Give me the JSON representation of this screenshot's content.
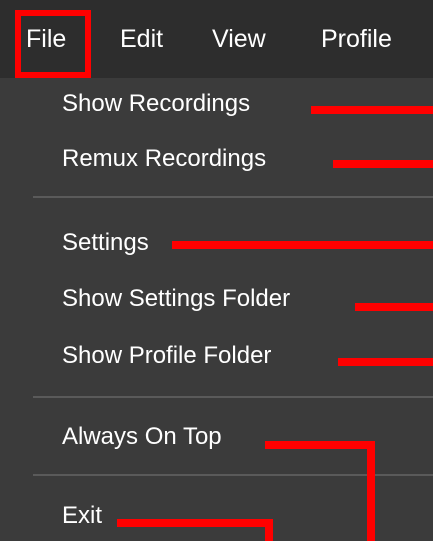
{
  "menubar": {
    "items": [
      "File",
      "Edit",
      "View",
      "Profile"
    ]
  },
  "file_menu": {
    "items": [
      "Show Recordings",
      "Remux Recordings",
      "Settings",
      "Show Settings Folder",
      "Show Profile Folder",
      "Always On Top",
      "Exit"
    ]
  },
  "colors": {
    "menu_background": "#3b3b3b",
    "menubar_background": "#2d2d2d",
    "highlight": "#ff0000",
    "text": "#ffffff"
  }
}
